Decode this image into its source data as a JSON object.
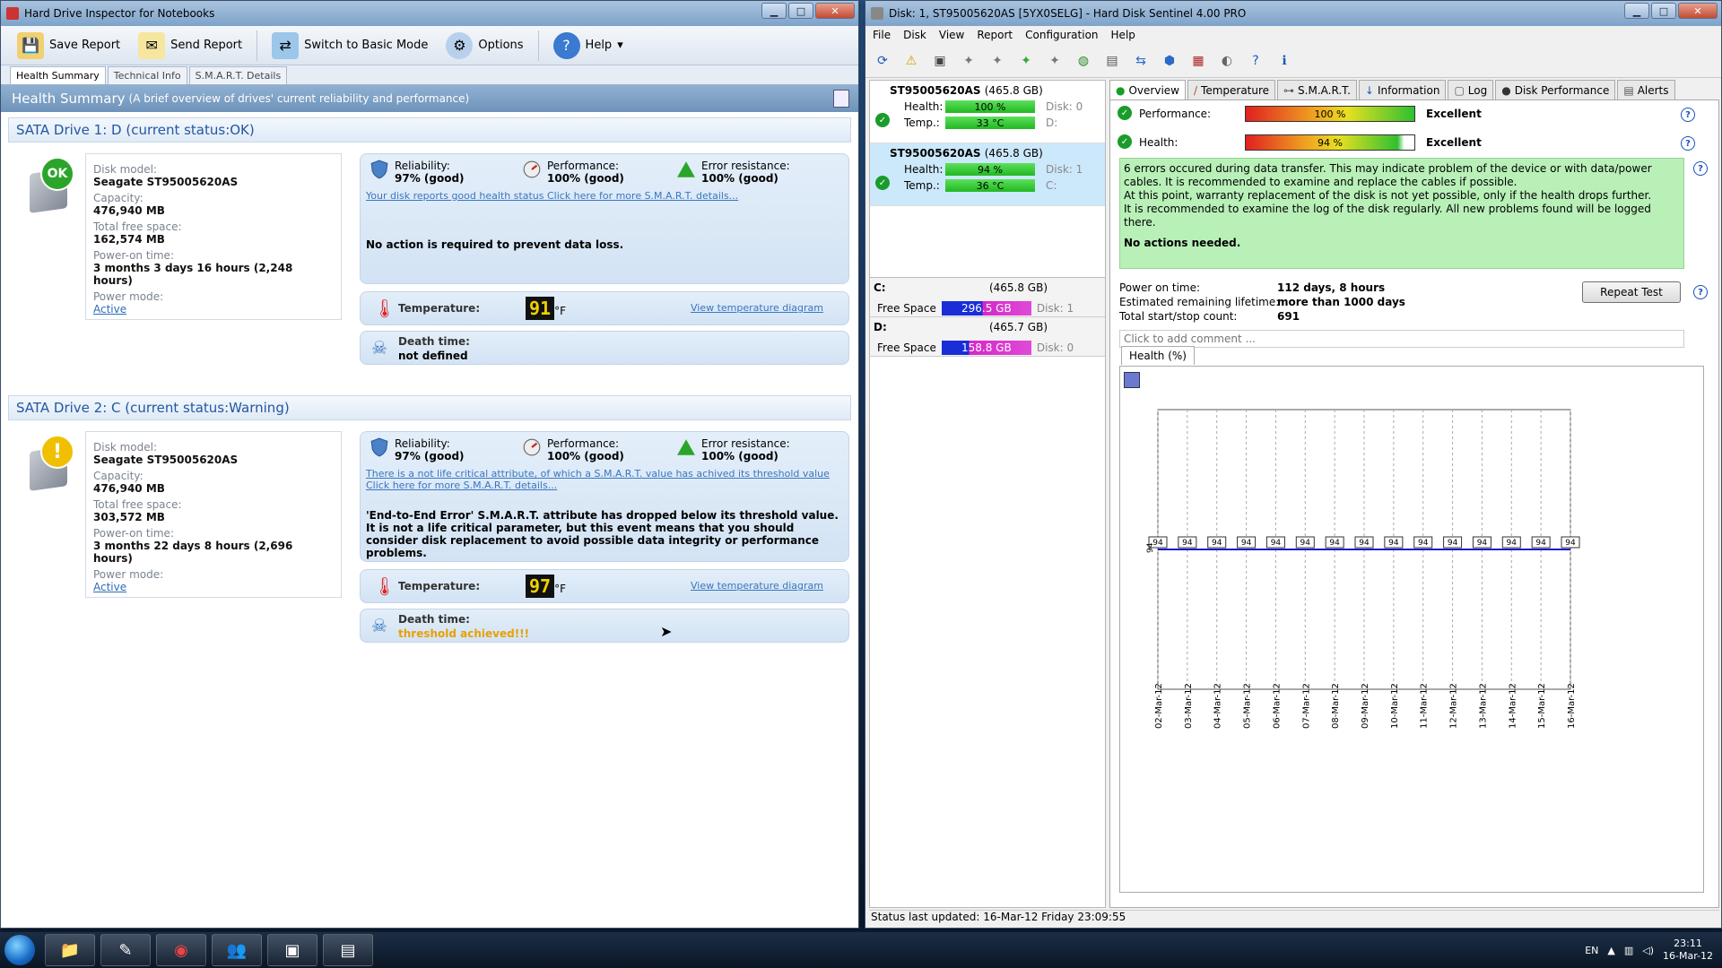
{
  "left_window": {
    "title": "Hard Drive Inspector for Notebooks",
    "toolbar": {
      "save_report": "Save Report",
      "send_report": "Send Report",
      "switch_mode": "Switch to Basic Mode",
      "options": "Options",
      "help": "Help"
    },
    "tabs": [
      "Health Summary",
      "Technical Info",
      "S.M.A.R.T. Details"
    ],
    "summary_title": "Health Summary",
    "summary_sub": "(A brief overview of drives' current reliability and performance)",
    "labels": {
      "disk_model": "Disk model:",
      "capacity": "Capacity:",
      "free_space": "Total free space:",
      "power_on": "Power-on time:",
      "power_mode": "Power mode:",
      "reliability": "Reliability:",
      "performance": "Performance:",
      "error_resistance": "Error resistance:",
      "temperature": "Temperature:",
      "death_time": "Death time:",
      "view_temp": "View temperature diagram",
      "deg": "°F"
    },
    "drives": [
      {
        "header": "SATA Drive 1: D (current status:OK)",
        "badge": "OK",
        "model": "Seagate ST95005620AS",
        "capacity": "476,940 MB",
        "free": "162,574 MB",
        "power_on": "3 months 3 days 16 hours (2,248 hours)",
        "power_mode": "Active",
        "reliability": "97% (good)",
        "performance": "100% (good)",
        "error_resistance": "100% (good)",
        "link": "Your disk reports good health status Click here for more S.M.A.R.T. details...",
        "message": "No action is required to prevent data loss.",
        "temp": "91",
        "death": "not defined"
      },
      {
        "header": "SATA Drive 2: C (current status:Warning)",
        "badge": "!",
        "model": "Seagate ST95005620AS",
        "capacity": "476,940 MB",
        "free": "303,572 MB",
        "power_on": "3 months 22 days 8 hours (2,696 hours)",
        "power_mode": "Active",
        "reliability": "97% (good)",
        "performance": "100% (good)",
        "error_resistance": "100% (good)",
        "link": "There is a not life critical attribute, of which a S.M.A.R.T. value has achived its threshold value Click here for more S.M.A.R.T. details...",
        "message": "'End-to-End Error' S.M.A.R.T. attribute has dropped below its threshold value. It is not a life critical parameter, but this event means that you should consider disk replacement to avoid possible data integrity or performance problems.",
        "temp": "97",
        "death": "threshold achieved!!!"
      }
    ]
  },
  "right_window": {
    "title": "Disk: 1, ST95005620AS [5YX0SELG] - Hard Disk Sentinel 4.00 PRO",
    "menu": [
      "File",
      "Disk",
      "View",
      "Report",
      "Configuration",
      "Help"
    ],
    "disks": [
      {
        "name": "ST95005620AS",
        "size": "(465.8 GB)",
        "health": "100 %",
        "disk": "Disk: 0",
        "temp": "33 °C",
        "drive": "D:"
      },
      {
        "name": "ST95005620AS",
        "size": "(465.8 GB)",
        "health": "94 %",
        "disk": "Disk: 1",
        "temp": "36 °C",
        "drive": "C:"
      }
    ],
    "disk_labels": {
      "health": "Health:",
      "temp": "Temp.:",
      "free_space": "Free Space"
    },
    "partitions": [
      {
        "letter": "C:",
        "size": "(465.8 GB)",
        "free": "296.5 GB",
        "disk": "Disk: 1"
      },
      {
        "letter": "D:",
        "size": "(465.7 GB)",
        "free": "158.8 GB",
        "disk": "Disk: 0"
      }
    ],
    "tabs": [
      "Overview",
      "Temperature",
      "S.M.A.R.T.",
      "Information",
      "Log",
      "Disk Performance",
      "Alerts"
    ],
    "performance": {
      "label": "Performance:",
      "value": "100 %",
      "rating": "Excellent"
    },
    "health": {
      "label": "Health:",
      "value": "94 %",
      "rating": "Excellent"
    },
    "message_lines": [
      "6 errors occured during data transfer. This may indicate problem of the device or with data/power cables. It is recommended to examine and replace the cables if possible.",
      "At this point, warranty replacement of the disk is not yet possible, only if the health drops further.",
      "It is recommended to examine the log of the disk regularly. All new problems found will be logged there."
    ],
    "no_actions": "No actions needed.",
    "stats": [
      {
        "label": "Power on time:",
        "value": "112 days, 8 hours"
      },
      {
        "label": "Estimated remaining lifetime:",
        "value": "more than 1000 days"
      },
      {
        "label": "Total start/stop count:",
        "value": "691"
      }
    ],
    "repeat_test": "Repeat Test",
    "comment_placeholder": "Click to add comment ...",
    "chart_tab": "Health (%)",
    "status": "Status last updated: 16-Mar-12 Friday 23:09:55"
  },
  "chart_data": {
    "type": "line",
    "title": "",
    "ylabel": "",
    "x": [
      "02-Mar-12",
      "03-Mar-12",
      "04-Mar-12",
      "05-Mar-12",
      "06-Mar-12",
      "07-Mar-12",
      "08-Mar-12",
      "09-Mar-12",
      "10-Mar-12",
      "11-Mar-12",
      "12-Mar-12",
      "13-Mar-12",
      "14-Mar-12",
      "15-Mar-12",
      "16-Mar-12"
    ],
    "series": [
      {
        "values": [
          94,
          94,
          94,
          94,
          94,
          94,
          94,
          94,
          94,
          94,
          94,
          94,
          94,
          94,
          94
        ]
      }
    ],
    "y_axis_label": "94",
    "ylim": [
      0,
      188
    ],
    "grid": "vertical dashed"
  },
  "taskbar": {
    "lang": "EN",
    "time": "23:11",
    "date": "16-Mar-12"
  }
}
